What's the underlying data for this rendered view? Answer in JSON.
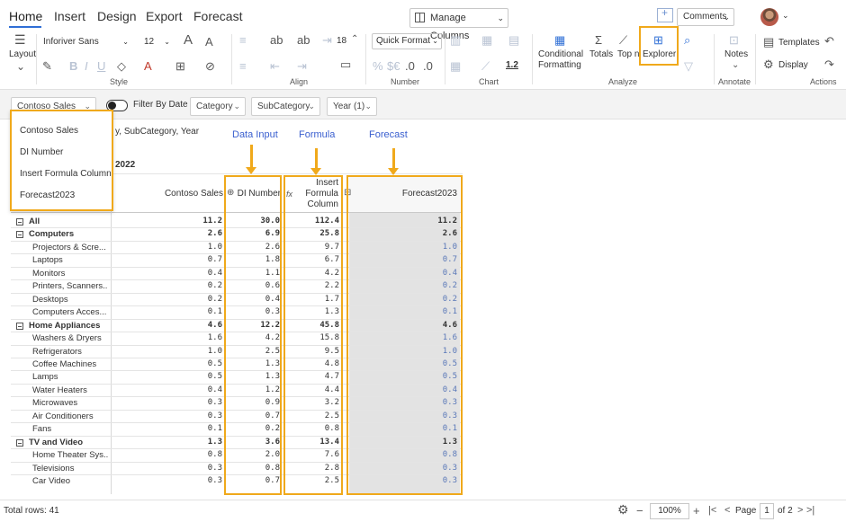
{
  "tabs": [
    "Home",
    "Insert",
    "Design",
    "Export",
    "Forecast"
  ],
  "header": {
    "manage_columns": "Manage Columns",
    "comments": "Comments"
  },
  "ribbon": {
    "layout_label": "Layout",
    "font_name": "Inforiver Sans",
    "font_size": "12",
    "indent_value": "18",
    "quick_format": "Quick Format",
    "number_sample": "1.2",
    "groups": {
      "style": "Style",
      "align": "Align",
      "number": "Number",
      "chart": "Chart",
      "analyze": "Analyze",
      "annotate": "Annotate",
      "actions": "Actions"
    },
    "conditional_formatting": [
      "Conditional",
      "Formatting"
    ],
    "totals": "Totals",
    "top_n": "Top n",
    "explorer": "Explorer",
    "notes": "Notes",
    "templates": "Templates",
    "display": "Display"
  },
  "filterbar": {
    "measure": "Contoso Sales",
    "filter_by_date": "Filter By Date",
    "category": "Category",
    "subcategory": "SubCategory",
    "year": "Year (1)"
  },
  "dropdown": {
    "items": [
      "Contoso Sales",
      "DI Number",
      "Insert Formula Column",
      "Forecast2023"
    ]
  },
  "annotations": {
    "data_input": "Data Input",
    "formula": "Formula",
    "forecast": "Forecast"
  },
  "table": {
    "subtitle": "y, SubCategory, Year",
    "year": "2022",
    "columns": [
      "Contoso Sales",
      "DI Number",
      "Insert Formula Column",
      "Forecast2023"
    ],
    "formula_col_lines": [
      "Insert",
      "Formula",
      "Column"
    ],
    "rows": [
      {
        "label": "All",
        "level": 0,
        "values": [
          "11.2",
          "30.0",
          "112.4",
          "11.2"
        ]
      },
      {
        "label": "Computers",
        "level": 1,
        "values": [
          "2.6",
          "6.9",
          "25.8",
          "2.6"
        ]
      },
      {
        "label": "Projectors & Scre...",
        "level": 2,
        "values": [
          "1.0",
          "2.6",
          "9.7",
          "1.0"
        ]
      },
      {
        "label": "Laptops",
        "level": 2,
        "values": [
          "0.7",
          "1.8",
          "6.7",
          "0.7"
        ]
      },
      {
        "label": "Monitors",
        "level": 2,
        "values": [
          "0.4",
          "1.1",
          "4.2",
          "0.4"
        ]
      },
      {
        "label": "Printers, Scanners...",
        "level": 2,
        "values": [
          "0.2",
          "0.6",
          "2.2",
          "0.2"
        ]
      },
      {
        "label": "Desktops",
        "level": 2,
        "values": [
          "0.2",
          "0.4",
          "1.7",
          "0.2"
        ]
      },
      {
        "label": "Computers Acces...",
        "level": 2,
        "values": [
          "0.1",
          "0.3",
          "1.3",
          "0.1"
        ]
      },
      {
        "label": "Home Appliances",
        "level": 1,
        "values": [
          "4.6",
          "12.2",
          "45.8",
          "4.6"
        ]
      },
      {
        "label": "Washers & Dryers",
        "level": 2,
        "values": [
          "1.6",
          "4.2",
          "15.8",
          "1.6"
        ]
      },
      {
        "label": "Refrigerators",
        "level": 2,
        "values": [
          "1.0",
          "2.5",
          "9.5",
          "1.0"
        ]
      },
      {
        "label": "Coffee Machines",
        "level": 2,
        "values": [
          "0.5",
          "1.3",
          "4.8",
          "0.5"
        ]
      },
      {
        "label": "Lamps",
        "level": 2,
        "values": [
          "0.5",
          "1.3",
          "4.7",
          "0.5"
        ]
      },
      {
        "label": "Water Heaters",
        "level": 2,
        "values": [
          "0.4",
          "1.2",
          "4.4",
          "0.4"
        ]
      },
      {
        "label": "Microwaves",
        "level": 2,
        "values": [
          "0.3",
          "0.9",
          "3.2",
          "0.3"
        ]
      },
      {
        "label": "Air Conditioners",
        "level": 2,
        "values": [
          "0.3",
          "0.7",
          "2.5",
          "0.3"
        ]
      },
      {
        "label": "Fans",
        "level": 2,
        "values": [
          "0.1",
          "0.2",
          "0.8",
          "0.1"
        ]
      },
      {
        "label": "TV and Video",
        "level": 1,
        "values": [
          "1.3",
          "3.6",
          "13.4",
          "1.3"
        ]
      },
      {
        "label": "Home Theater Sys...",
        "level": 2,
        "values": [
          "0.8",
          "2.0",
          "7.6",
          "0.8"
        ]
      },
      {
        "label": "Televisions",
        "level": 2,
        "values": [
          "0.3",
          "0.8",
          "2.8",
          "0.3"
        ]
      },
      {
        "label": "Car Video",
        "level": 2,
        "values": [
          "0.3",
          "0.7",
          "2.5",
          "0.3"
        ]
      }
    ]
  },
  "status": {
    "total_rows": "Total rows: 41",
    "zoom": "100%",
    "page_label": "Page",
    "page": "1",
    "page_of": "of 2"
  },
  "colors": {
    "accent_highlight": "#f0a91b",
    "annotation_text": "#3a5fcf",
    "forecast_value": "#5a78b8"
  }
}
